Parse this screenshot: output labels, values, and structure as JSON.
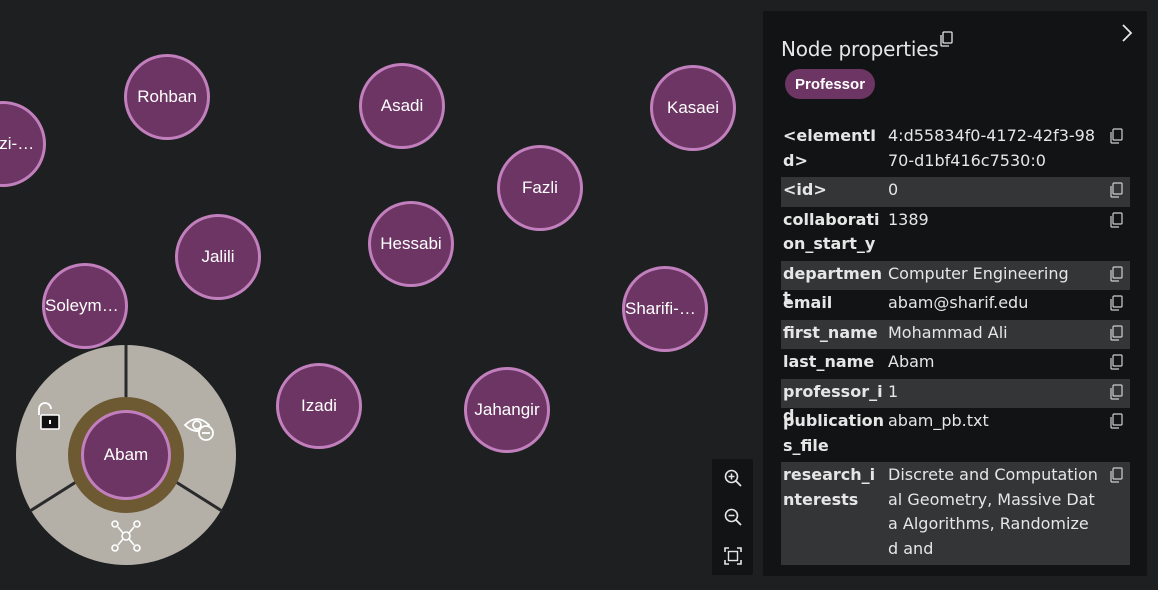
{
  "graph": {
    "nodes": [
      {
        "id": "node-gazi",
        "label": "Ghazi-…",
        "display": "azi-…"
      },
      {
        "id": "node-rohban",
        "label": "Rohban"
      },
      {
        "id": "node-asadi",
        "label": "Asadi"
      },
      {
        "id": "node-kasaei",
        "label": "Kasaei"
      },
      {
        "id": "node-fazli",
        "label": "Fazli"
      },
      {
        "id": "node-hessabi",
        "label": "Hessabi"
      },
      {
        "id": "node-jalili",
        "label": "Jalili"
      },
      {
        "id": "node-soleymani",
        "label": "Soleyma…"
      },
      {
        "id": "node-sharifi",
        "label": "Sharifi-Z…"
      },
      {
        "id": "node-izadi",
        "label": "Izadi"
      },
      {
        "id": "node-jahangir",
        "label": "Jahangir"
      }
    ],
    "focus_node": {
      "label": "Abam"
    },
    "radial_menu": {
      "actions": [
        "unlock-icon",
        "hide-node-icon",
        "expand-relationships-icon"
      ]
    }
  },
  "zoom_controls": [
    "zoom-in-icon",
    "zoom-out-icon",
    "fit-to-screen-icon"
  ],
  "panel": {
    "title": "Node properties",
    "label_chip": "Professor",
    "properties": [
      {
        "key": "<elementId>",
        "value": "4:d55834f0-4172-42f3-9870-d1bf416c7530:0"
      },
      {
        "key": "<id>",
        "value": "0"
      },
      {
        "key": "collaboration_start_year",
        "value": "1389"
      },
      {
        "key": "department",
        "value": "Computer Engineering"
      },
      {
        "key": "email",
        "value": "abam@sharif.edu"
      },
      {
        "key": "first_name",
        "value": "Mohammad Ali"
      },
      {
        "key": "last_name",
        "value": "Abam"
      },
      {
        "key": "professor_id",
        "value": "1"
      },
      {
        "key": "publications_file",
        "value": "abam_pb.txt"
      },
      {
        "key": "research_interests",
        "value": "Discrete and Computational Geometry, Massive Data Algorithms, Randomized and"
      }
    ]
  },
  "colors": {
    "background": "#1e1f21",
    "node_fill": "#6c3563",
    "node_border": "#c27fbd",
    "panel_bg": "#121314",
    "row_alt": "#343537",
    "radial_bg": "#b4b0a8",
    "focus_ring": "#6e5a32"
  }
}
